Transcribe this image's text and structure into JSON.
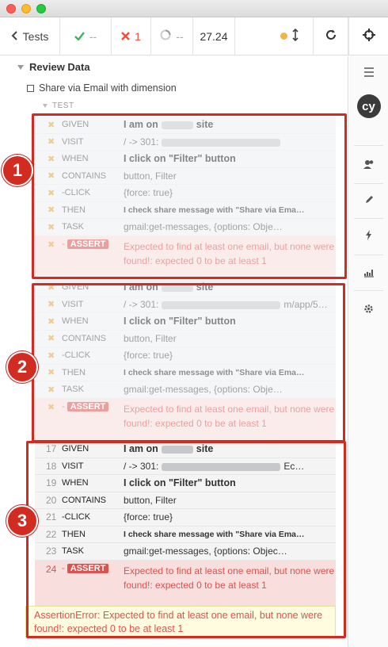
{
  "header": {
    "tests_label": "Tests",
    "passed": "--",
    "failed": "1",
    "pending": "--",
    "duration": "27.24"
  },
  "suite": {
    "title": "Review Data",
    "test_title": "Share via Email with dimension",
    "block_label": "TEST"
  },
  "groups": [
    {
      "commands": [
        {
          "name": "GIVEN",
          "msg": "I am on",
          "suffix": "site",
          "style": "bold"
        },
        {
          "name": "VISIT",
          "msg": "/ -> 301:",
          "style": "normal"
        },
        {
          "name": "WHEN",
          "msg": "I click on \"Filter\" button",
          "style": "bold"
        },
        {
          "name": "CONTAINS",
          "msg": "button, Filter",
          "style": "normal"
        },
        {
          "name": "-CLICK",
          "msg": "{force: true}",
          "style": "normal"
        },
        {
          "name": "THEN",
          "msg": "I check share message with \"Share via Ema…",
          "style": "small"
        },
        {
          "name": "TASK",
          "msg": "gmail:get-messages, {options: Obje…",
          "style": "normal"
        },
        {
          "name": "ASSERT",
          "msg": "Expected to find at least one email, but none were found!: expected 0 to be at least 1",
          "style": "assert"
        }
      ]
    },
    {
      "commands": [
        {
          "name": "GIVEN",
          "msg": "I am on",
          "suffix": "site",
          "style": "bold"
        },
        {
          "name": "VISIT",
          "msg": "/ -> 301:",
          "suffix": "m/app/5…",
          "style": "normal"
        },
        {
          "name": "WHEN",
          "msg": "I click on \"Filter\" button",
          "style": "bold"
        },
        {
          "name": "CONTAINS",
          "msg": "button, Filter",
          "style": "normal"
        },
        {
          "name": "-CLICK",
          "msg": "{force: true}",
          "style": "normal"
        },
        {
          "name": "THEN",
          "msg": "I check share message with \"Share via Ema…",
          "style": "small"
        },
        {
          "name": "TASK",
          "msg": "gmail:get-messages, {options: Obje…",
          "style": "normal"
        },
        {
          "name": "ASSERT",
          "msg": "Expected to find at least one email, but none were found!: expected 0 to be at least 1",
          "style": "assert"
        }
      ]
    },
    {
      "commands": [
        {
          "num": "17",
          "name": "GIVEN",
          "msg": "I am on",
          "suffix": "site",
          "style": "bold"
        },
        {
          "num": "18",
          "name": "VISIT",
          "msg": "/ -> 301:",
          "suffix": "Ec…",
          "style": "normal"
        },
        {
          "num": "19",
          "name": "WHEN",
          "msg": "I click on \"Filter\" button",
          "style": "bold"
        },
        {
          "num": "20",
          "name": "CONTAINS",
          "msg": "button, Filter",
          "style": "normal"
        },
        {
          "num": "21",
          "name": "-CLICK",
          "msg": "{force: true}",
          "style": "normal"
        },
        {
          "num": "22",
          "name": "THEN",
          "msg": "I check share message with \"Share via Ema…",
          "style": "small"
        },
        {
          "num": "23",
          "name": "TASK",
          "msg": "gmail:get-messages, {options: Objec…",
          "style": "normal"
        },
        {
          "num": "24",
          "name": "ASSERT",
          "msg": "Expected to find at least one email, but none were found!: expected 0 to be at least 1",
          "style": "assert"
        }
      ]
    }
  ],
  "error": {
    "text": "AssertionError: Expected to find at least one email, but none were found!: expected 0 to be at least 1"
  },
  "annotations": [
    "1",
    "2",
    "3"
  ],
  "colors": {
    "annotation": "#d22c22",
    "failed": "#e94f3c",
    "passed": "#3eb35e",
    "running": "#f0b54a"
  }
}
